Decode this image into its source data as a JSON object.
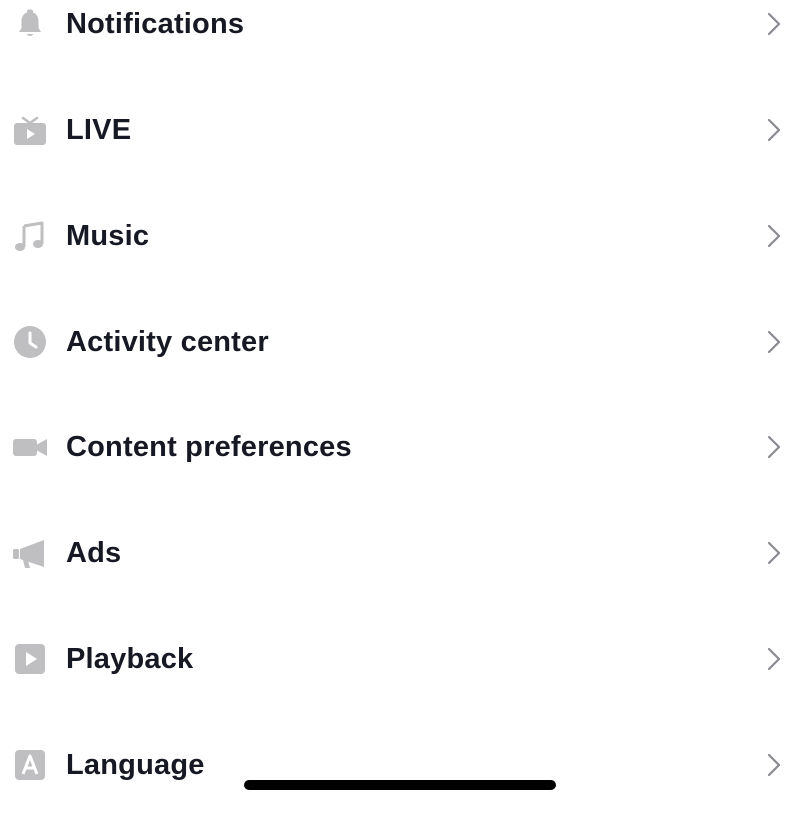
{
  "colors": {
    "icon": "#bfbfc1",
    "label": "#161823",
    "chevron": "#8a8b91",
    "background": "#ffffff",
    "home_indicator": "#000000"
  },
  "settings": {
    "items": [
      {
        "label": "Notifications",
        "icon": "bell-icon"
      },
      {
        "label": "LIVE",
        "icon": "tv-icon"
      },
      {
        "label": "Music",
        "icon": "music-note-icon"
      },
      {
        "label": "Activity center",
        "icon": "clock-icon"
      },
      {
        "label": "Content preferences",
        "icon": "video-camera-icon"
      },
      {
        "label": "Ads",
        "icon": "megaphone-icon"
      },
      {
        "label": "Playback",
        "icon": "play-square-icon"
      },
      {
        "label": "Language",
        "icon": "letter-a-icon"
      }
    ]
  }
}
